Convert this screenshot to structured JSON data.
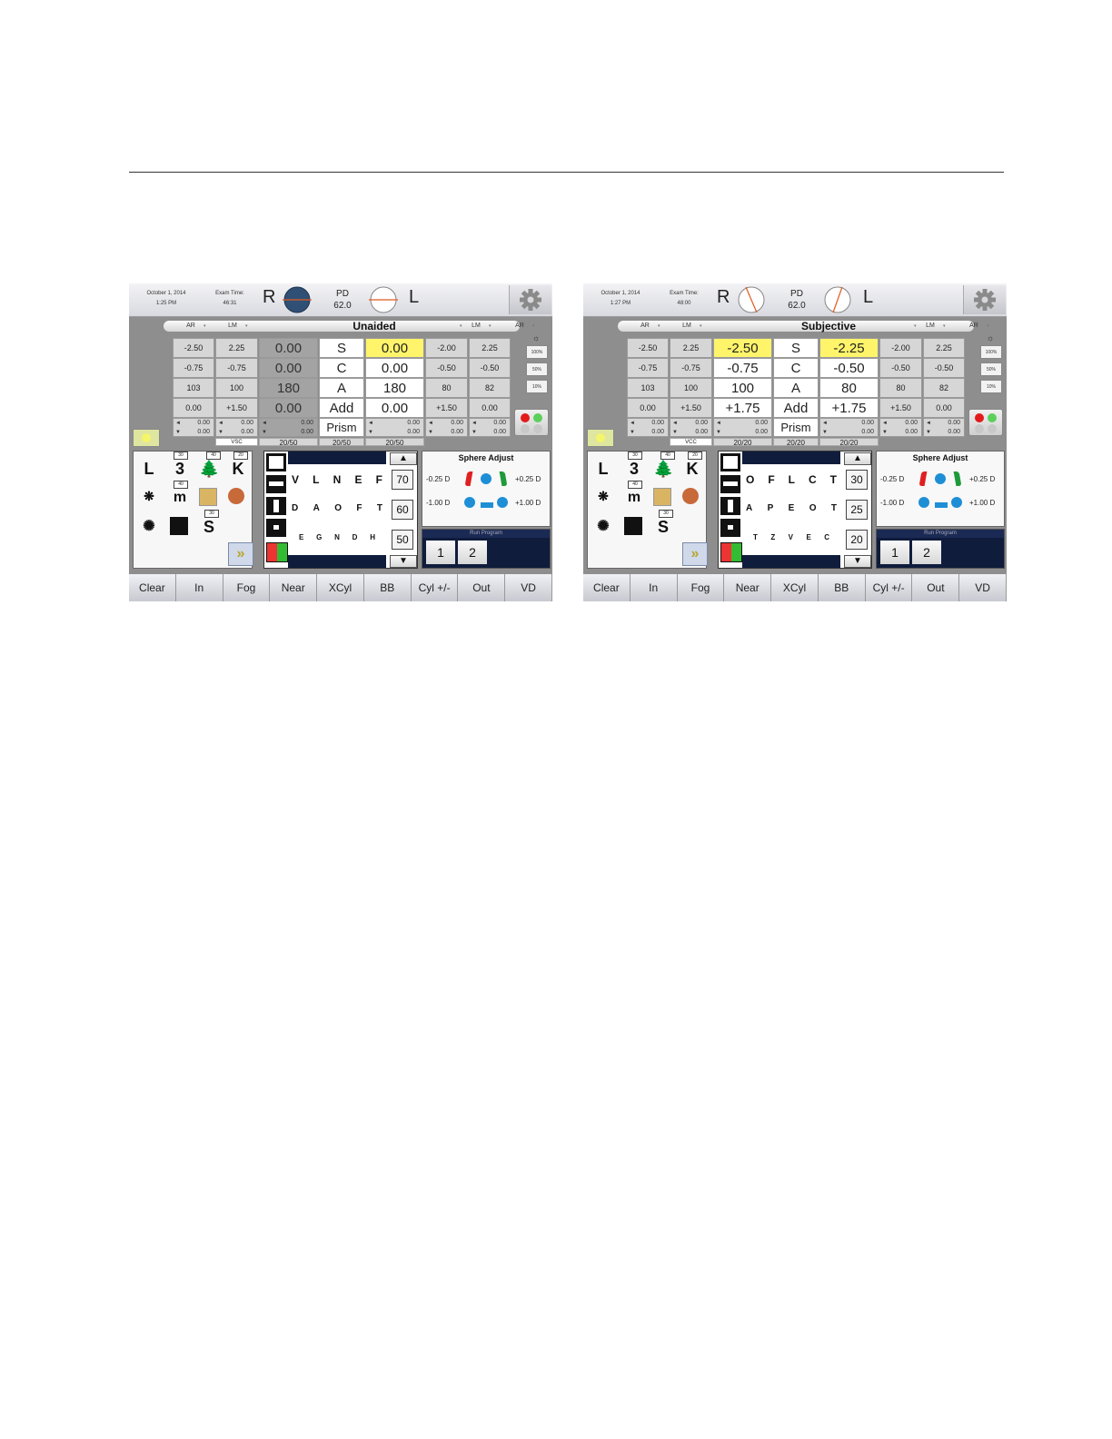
{
  "panels": [
    {
      "date": "October 1, 2014",
      "time": "1:25 PM",
      "exam_time_label": "Exam Time:",
      "exam_time": "46:31",
      "eye_r": "R",
      "eye_l": "L",
      "pd_label": "PD",
      "pd_value": "62.0",
      "source_ar": "AR",
      "source_lm": "LM",
      "mode": "Unaided",
      "rows": [
        {
          "ar_r": "-2.50",
          "lm_r": "2.25",
          "val_r": "0.00",
          "label": "S",
          "val_l": "0.00",
          "lm_l": "-2.00",
          "ar_l": "2.25"
        },
        {
          "ar_r": "-0.75",
          "lm_r": "-0.75",
          "val_r": "0.00",
          "label": "C",
          "val_l": "0.00",
          "lm_l": "-0.50",
          "ar_l": "-0.50"
        },
        {
          "ar_r": "103",
          "lm_r": "100",
          "val_r": "180",
          "label": "A",
          "val_l": "180",
          "lm_l": "80",
          "ar_l": "82"
        },
        {
          "ar_r": "0.00",
          "lm_r": "+1.50",
          "val_r": "0.00",
          "label": "Add",
          "val_l": "0.00",
          "lm_l": "+1.50",
          "ar_l": "0.00"
        }
      ],
      "prism_label": "Prism",
      "prism_value": "0.00",
      "va": {
        "label": "VSC",
        "r": "20/50",
        "center": "20/50",
        "l": "20/50"
      },
      "percents": [
        "100%",
        "50%",
        "10%"
      ],
      "letter_rows": [
        [
          "V",
          "L",
          "N",
          "E",
          "F"
        ],
        [
          "D",
          "A",
          "O",
          "F",
          "T"
        ],
        [
          "E",
          "G",
          "N",
          "D",
          "H"
        ]
      ],
      "va_buttons": [
        "70",
        "60",
        "50"
      ],
      "sphere": {
        "title": "Sphere Adjust",
        "minus_small": "-0.25 D",
        "plus_small": "+0.25 D",
        "minus_big": "-1.00 D",
        "plus_big": "+1.00 D"
      },
      "run_program": {
        "title": "Run Program",
        "buttons": [
          "1",
          "2"
        ]
      },
      "chart_icons": {
        "l": "L",
        "three": "3",
        "k": "K",
        "m": "m",
        "s": "S",
        "tag_30": "30",
        "tag_40": "40",
        "tag_20": "20",
        "tag_40b": "40",
        "tag_30b": "30"
      }
    },
    {
      "date": "October 1, 2014",
      "time": "1:27 PM",
      "exam_time_label": "Exam Time:",
      "exam_time": "48:00",
      "eye_r": "R",
      "eye_l": "L",
      "pd_label": "PD",
      "pd_value": "62.0",
      "source_ar": "AR",
      "source_lm": "LM",
      "mode": "Subjective",
      "rows": [
        {
          "ar_r": "-2.50",
          "lm_r": "2.25",
          "val_r": "-2.50",
          "label": "S",
          "val_l": "-2.25",
          "lm_l": "-2.00",
          "ar_l": "2.25"
        },
        {
          "ar_r": "-0.75",
          "lm_r": "-0.75",
          "val_r": "-0.75",
          "label": "C",
          "val_l": "-0.50",
          "lm_l": "-0.50",
          "ar_l": "-0.50"
        },
        {
          "ar_r": "103",
          "lm_r": "100",
          "val_r": "100",
          "label": "A",
          "val_l": "80",
          "lm_l": "80",
          "ar_l": "82"
        },
        {
          "ar_r": "0.00",
          "lm_r": "+1.50",
          "val_r": "+1.75",
          "label": "Add",
          "val_l": "+1.75",
          "lm_l": "+1.50",
          "ar_l": "0.00"
        }
      ],
      "prism_label": "Prism",
      "prism_value": "0.00",
      "va": {
        "label": "VCC",
        "r": "20/20",
        "center": "20/20",
        "l": "20/20"
      },
      "percents": [
        "100%",
        "50%",
        "10%"
      ],
      "letter_rows": [
        [
          "O",
          "F",
          "L",
          "C",
          "T"
        ],
        [
          "A",
          "P",
          "E",
          "O",
          "T"
        ],
        [
          "T",
          "Z",
          "V",
          "E",
          "C"
        ]
      ],
      "va_buttons": [
        "30",
        "25",
        "20"
      ],
      "sphere": {
        "title": "Sphere Adjust",
        "minus_small": "-0.25 D",
        "plus_small": "+0.25 D",
        "minus_big": "-1.00 D",
        "plus_big": "+1.00 D"
      },
      "run_program": {
        "title": "Run Program",
        "buttons": [
          "1",
          "2"
        ]
      },
      "chart_icons": {
        "l": "L",
        "three": "3",
        "k": "K",
        "m": "m",
        "s": "S",
        "tag_30": "30",
        "tag_40": "40",
        "tag_20": "20",
        "tag_40b": "40",
        "tag_30b": "30"
      }
    }
  ],
  "bottom_buttons": [
    "Clear",
    "In",
    "Fog",
    "Near",
    "XCyl",
    "BB",
    "Cyl +/-",
    "Out",
    "VD"
  ],
  "colors": {
    "highlight": "#fff46a",
    "dark_band": "#0f1c3c",
    "ball": "#1e8fd6"
  }
}
